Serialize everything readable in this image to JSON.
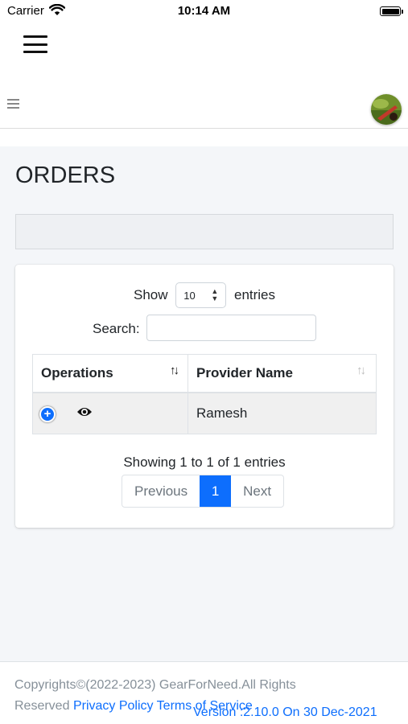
{
  "status_bar": {
    "carrier": "Carrier",
    "time": "10:14 AM"
  },
  "page": {
    "title": "ORDERS"
  },
  "table_controls": {
    "show_label": "Show",
    "entries_select_value": "10",
    "entries_label": "entries",
    "search_label": "Search:",
    "search_value": ""
  },
  "table": {
    "columns": [
      "Operations",
      "Provider Name"
    ],
    "rows": [
      {
        "provider_name": "Ramesh"
      }
    ]
  },
  "pagination": {
    "info": "Showing 1 to 1 of 1 entries",
    "previous": "Previous",
    "current_page": "1",
    "next": "Next"
  },
  "footer": {
    "copyright": "Copyrights©(2022-2023) GearForNeed.All Rights Reserved",
    "privacy": "Privacy Policy",
    "terms": "Terms of Service",
    "version": "Version :2.10.0 On 30 Dec-2021"
  },
  "colors": {
    "primary": "#0d6efd",
    "content_bg": "#f4f6f9"
  },
  "icons": [
    "wifi-icon",
    "battery-icon",
    "hamburger-menu-icon",
    "sidebar-toggle-icon",
    "avatar",
    "sort-icon",
    "expand-row-icon",
    "eye-icon"
  ]
}
